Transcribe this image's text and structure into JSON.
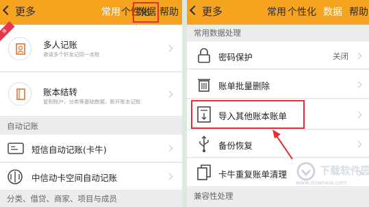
{
  "left": {
    "back": "更多",
    "tabs": [
      "常用",
      "个性化",
      "数据",
      "帮助"
    ],
    "ribbon": "推",
    "items": [
      {
        "title": "多人记账",
        "sub": "邀请多个好友记同一本账"
      },
      {
        "title": "账本结转",
        "sub": "复制账户，分类等基础数据，新开账本记账"
      }
    ],
    "section_auto": "自动记账",
    "auto_items": [
      "短信自动记账(卡牛)",
      "中信动卡空间自动记账"
    ],
    "section_bottom": "分类、借贷、商家、项目与成员"
  },
  "right": {
    "back": "更多",
    "tabs": [
      "常用",
      "个性化",
      "数据",
      "帮助"
    ],
    "section_common": "常用数据处理",
    "items": [
      {
        "title": "密码保护",
        "status": "关闭"
      },
      {
        "title": "账单批量删除"
      },
      {
        "title": "导入其他账本账单"
      },
      {
        "title": "备份恢复"
      },
      {
        "title": "卡牛重复账单清理"
      }
    ],
    "section_compat": "兼容性处理"
  },
  "watermark": {
    "text": "下载软件园",
    "url": "www.downxia.com"
  },
  "colors": {
    "accent": "#f6a31f",
    "highlight": "#e62e2e"
  }
}
